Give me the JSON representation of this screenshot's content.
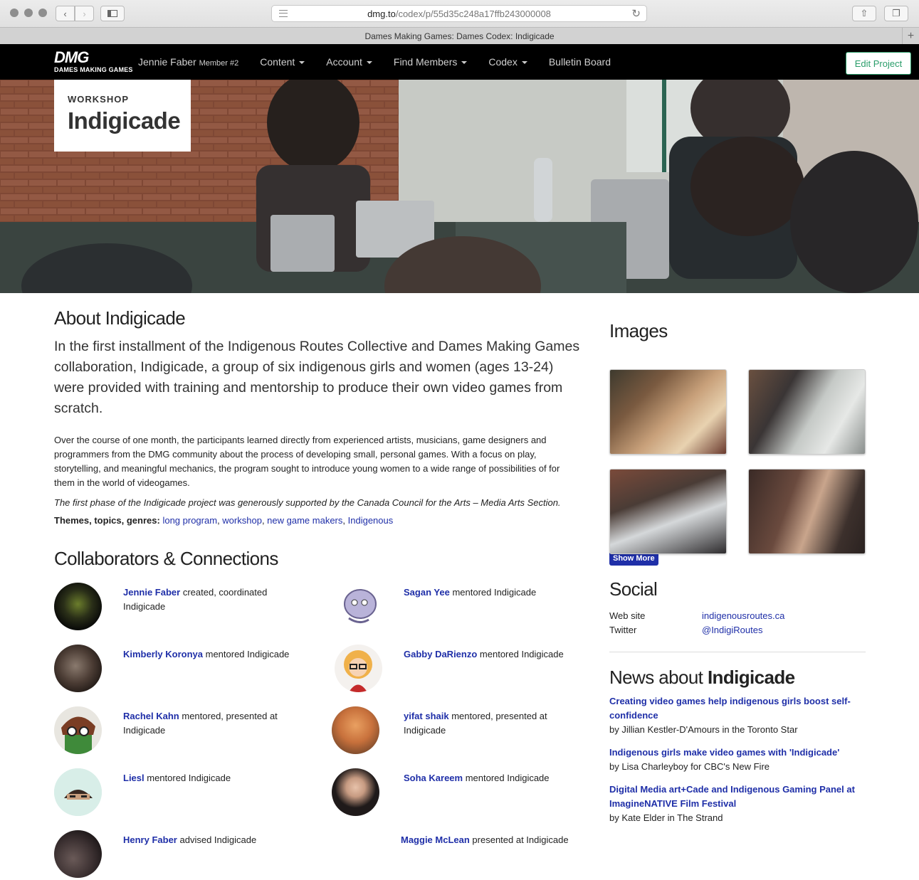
{
  "browser": {
    "url_host": "dmg.to",
    "url_path": "/codex/p/55d35c248a17ffb243000008",
    "tab_title": "Dames Making Games: Dames Codex: Indigicade"
  },
  "nav": {
    "logo_big": "DMG",
    "logo_small": "DAMES MAKING GAMES",
    "user_name": "Jennie Faber",
    "user_member": "Member #2",
    "items": [
      "Content",
      "Account",
      "Find Members",
      "Codex",
      "Bulletin Board"
    ],
    "edit_button": "Edit Project"
  },
  "hero": {
    "kicker": "WORKSHOP",
    "title": "Indigicade"
  },
  "about": {
    "heading": "About Indigicade",
    "lead": "In the first installment of the Indigenous Routes Collective and Dames Making Games collaboration, Indigicade, a group of six indigenous girls and women (ages 13-24) were provided with training and mentorship to produce their own video games from scratch.",
    "body": "Over the course of one month, the participants learned directly from experienced artists, musicians, game designers and programmers from the DMG community about the process of developing small, personal games. With a focus on play, storytelling, and meaningful mechanics, the program sought to introduce young women to a wide range of possibilities of for them in the world of videogames.",
    "support": "The first phase of the Indigicade project was generously supported by the Canada Council for the Arts – Media Arts Section.",
    "themes_label": "Themes, topics, genres:",
    "themes": [
      "long program",
      "workshop",
      "new game makers",
      "Indigenous"
    ]
  },
  "collaborators": {
    "heading": "Collaborators & Connections",
    "items": [
      {
        "name": "Jennie Faber",
        "role": "created, coordinated Indigicade"
      },
      {
        "name": "Sagan Yee",
        "role": "mentored Indigicade"
      },
      {
        "name": "Kimberly Koronya",
        "role": "mentored Indigicade"
      },
      {
        "name": "Gabby DaRienzo",
        "role": "mentored Indigicade"
      },
      {
        "name": "Rachel Kahn",
        "role": "mentored, presented at Indigicade"
      },
      {
        "name": "yifat shaik",
        "role": "mentored, presented at Indigicade"
      },
      {
        "name": "Liesl",
        "role": "mentored Indigicade"
      },
      {
        "name": "Soha Kareem",
        "role": "mentored Indigicade"
      },
      {
        "name": "Henry Faber",
        "role": "advised Indigicade"
      },
      {
        "name": "Maggie McLean",
        "role": "presented at Indigicade"
      }
    ]
  },
  "images": {
    "heading": "Images",
    "show_more": "Show More"
  },
  "social": {
    "heading": "Social",
    "rows": [
      {
        "label": "Web site",
        "value": "indigenousroutes.ca"
      },
      {
        "label": "Twitter",
        "value": "@IndigiRoutes"
      }
    ]
  },
  "news": {
    "heading_prefix": "News about",
    "heading_name": "Indigicade",
    "items": [
      {
        "title": "Creating video games help indigenous girls boost self-confidence",
        "byline": "by Jillian Kestler-D'Amours in the Toronto Star"
      },
      {
        "title": "Indigenous girls make video games with 'Indigicade'",
        "byline": "by Lisa Charleyboy for CBC's New Fire"
      },
      {
        "title": "Digital Media art+Cade and Indigenous Gaming Panel at ImagineNATIVE Film Festival",
        "byline": "by Kate Elder in The Strand"
      }
    ]
  }
}
